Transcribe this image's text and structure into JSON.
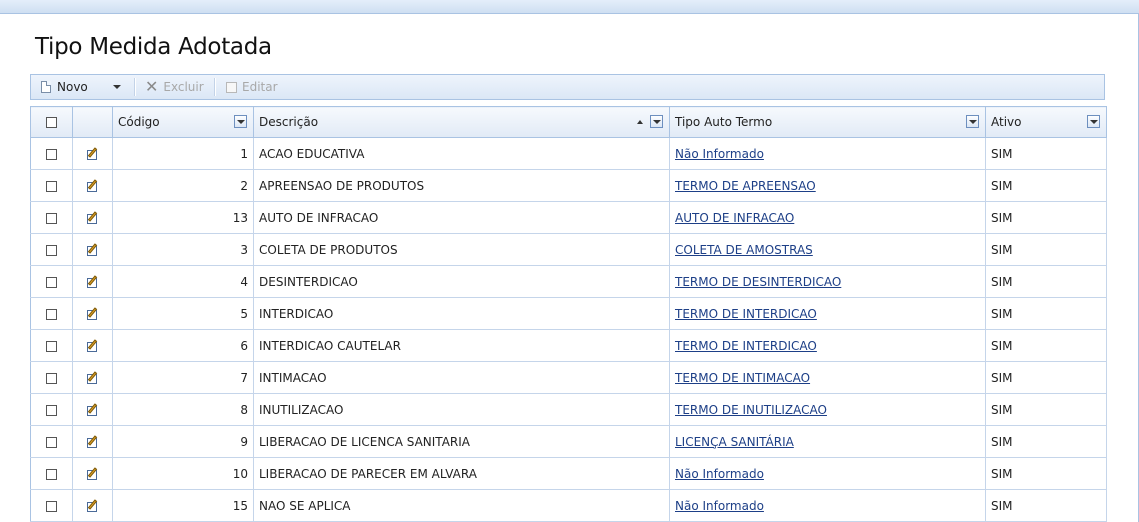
{
  "page": {
    "title": "Tipo Medida Adotada"
  },
  "toolbar": {
    "new_label": "Novo",
    "delete_label": "Excluir",
    "edit_label": "Editar"
  },
  "grid": {
    "columns": {
      "code": "Código",
      "description": "Descrição",
      "auto_term_type": "Tipo Auto Termo",
      "active": "Ativo"
    },
    "rows": [
      {
        "code": "1",
        "description": "ACAO EDUCATIVA",
        "auto_term_type": "Não Informado",
        "active": "SIM"
      },
      {
        "code": "2",
        "description": "APREENSAO DE PRODUTOS",
        "auto_term_type": "TERMO DE APREENSAO",
        "active": "SIM"
      },
      {
        "code": "13",
        "description": "AUTO DE INFRACAO",
        "auto_term_type": "AUTO DE INFRACAO",
        "active": "SIM"
      },
      {
        "code": "3",
        "description": "COLETA DE PRODUTOS",
        "auto_term_type": "COLETA DE AMOSTRAS",
        "active": "SIM"
      },
      {
        "code": "4",
        "description": "DESINTERDICAO",
        "auto_term_type": "TERMO DE DESINTERDICAO",
        "active": "SIM"
      },
      {
        "code": "5",
        "description": "INTERDICAO",
        "auto_term_type": "TERMO DE INTERDICAO",
        "active": "SIM"
      },
      {
        "code": "6",
        "description": "INTERDICAO CAUTELAR",
        "auto_term_type": "TERMO DE INTERDICAO",
        "active": "SIM"
      },
      {
        "code": "7",
        "description": "INTIMACAO",
        "auto_term_type": "TERMO DE INTIMACAO",
        "active": "SIM"
      },
      {
        "code": "8",
        "description": "INUTILIZACAO",
        "auto_term_type": "TERMO DE INUTILIZACAO",
        "active": "SIM"
      },
      {
        "code": "9",
        "description": "LIBERACAO DE LICENCA SANITARIA",
        "auto_term_type": "LICENÇA SANITÁRIA",
        "active": "SIM"
      },
      {
        "code": "10",
        "description": "LIBERACAO DE PARECER EM ALVARA",
        "auto_term_type": "Não Informado",
        "active": "SIM"
      },
      {
        "code": "15",
        "description": "NAO SE APLICA",
        "auto_term_type": "Não Informado",
        "active": "SIM"
      }
    ]
  }
}
